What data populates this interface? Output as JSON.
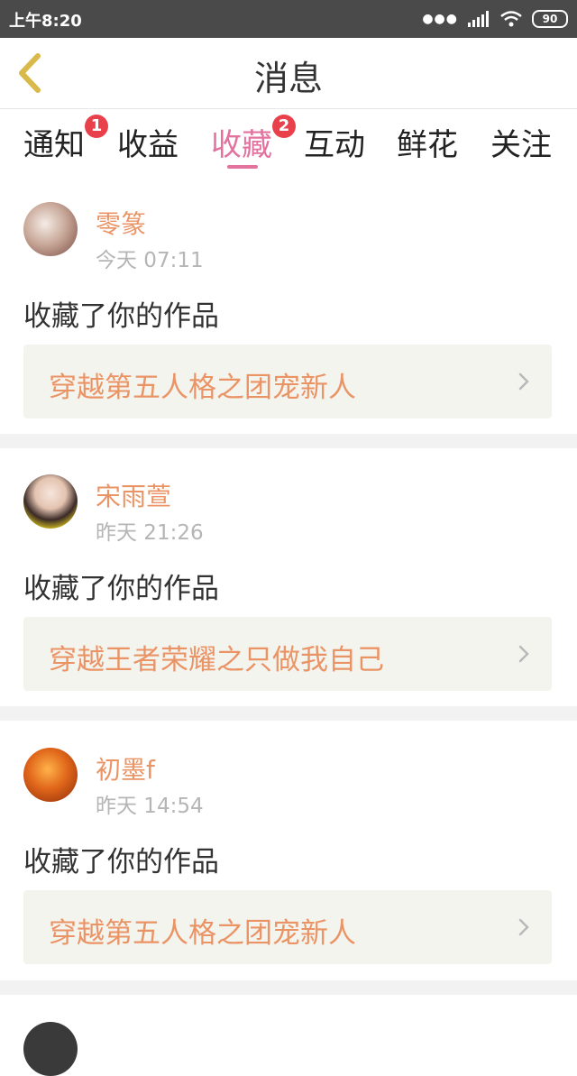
{
  "status_bar": {
    "time": "上午8:20",
    "battery": "90"
  },
  "header": {
    "title": "消息"
  },
  "tabs": [
    {
      "label": "通知",
      "badge": "1"
    },
    {
      "label": "收益"
    },
    {
      "label": "收藏",
      "badge": "2",
      "active": true
    },
    {
      "label": "互动"
    },
    {
      "label": "鲜花"
    },
    {
      "label": "关注"
    }
  ],
  "messages": [
    {
      "user": "零篆",
      "time": "今天 07:11",
      "action": "收藏了你的作品",
      "work": "穿越第五人格之团宠新人"
    },
    {
      "user": "宋雨萱",
      "time": "昨天 21:26",
      "action": "收藏了你的作品",
      "work": "穿越王者荣耀之只做我自己"
    },
    {
      "user": "初墨f",
      "time": "昨天 14:54",
      "action": "收藏了你的作品",
      "work": "穿越第五人格之团宠新人"
    }
  ],
  "colors": {
    "accent": "#e3729e",
    "name": "#ea9466",
    "badge": "#e9414b"
  },
  "icons": {
    "back": "chevron-left-icon",
    "item_arrow": "chevron-right-icon"
  }
}
